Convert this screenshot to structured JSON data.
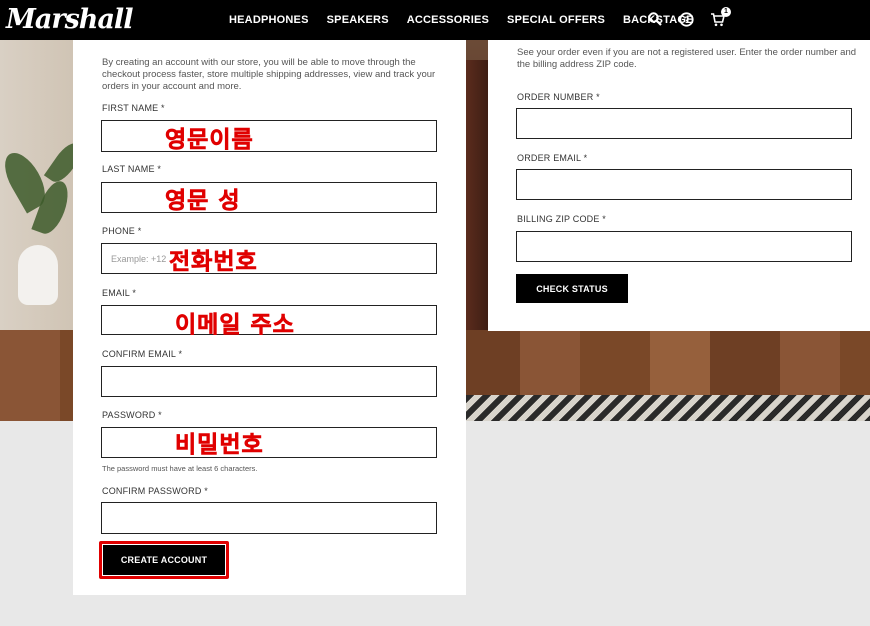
{
  "header": {
    "logo": "Marshall",
    "nav": [
      "HEADPHONES",
      "SPEAKERS",
      "ACCESSORIES",
      "SPECIAL OFFERS",
      "BACKSTAGE"
    ],
    "icons": [
      "search-icon",
      "help-icon",
      "cart-icon"
    ],
    "cart_count": "1"
  },
  "create_account": {
    "description": "By creating an account with our store, you will be able to move through the checkout process faster, store multiple shipping addresses, view and track your orders in your account and more.",
    "fields": {
      "first_name": {
        "label": "FIRST NAME *",
        "value": ""
      },
      "last_name": {
        "label": "LAST NAME *",
        "value": ""
      },
      "phone": {
        "label": "PHONE *",
        "placeholder": "Example: +12"
      },
      "email": {
        "label": "EMAIL *",
        "value": ""
      },
      "confirm_email": {
        "label": "CONFIRM EMAIL *",
        "value": ""
      },
      "password": {
        "label": "PASSWORD *",
        "value": ""
      },
      "confirm_password": {
        "label": "CONFIRM PASSWORD *",
        "value": ""
      }
    },
    "password_hint": "The password must have at least 6 characters.",
    "submit_label": "CREATE ACCOUNT",
    "annotations": {
      "first_name": "영문이름",
      "last_name": "영문 성",
      "phone": "전화번호",
      "email": "이메일 주소",
      "password": "비밀번호"
    }
  },
  "order_status": {
    "description": "See your order even if you are not a registered user. Enter the order number and the billing address ZIP code.",
    "fields": {
      "order_number": {
        "label": "ORDER NUMBER *",
        "value": ""
      },
      "order_email": {
        "label": "ORDER EMAIL *",
        "value": ""
      },
      "billing_zip": {
        "label": "BILLING ZIP CODE *",
        "value": ""
      }
    },
    "submit_label": "CHECK STATUS"
  },
  "colors": {
    "header_bg": "#000000",
    "annotation": "#e00000",
    "button_bg": "#000000"
  }
}
